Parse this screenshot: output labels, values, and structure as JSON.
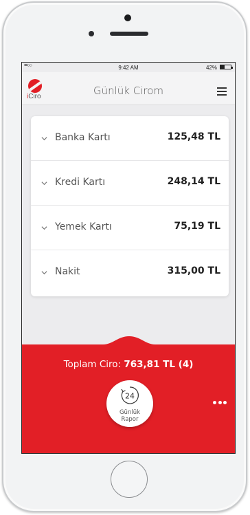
{
  "statusbar": {
    "signal": "•••○○",
    "time": "9:42 AM",
    "battery": "42%",
    "battery_level": 0.42
  },
  "header": {
    "logo_letter": "i",
    "logo_rest": "Ciro",
    "title": "Günlük Cirom"
  },
  "payments": [
    {
      "label": "Banka Kartı",
      "value": "125,48 TL"
    },
    {
      "label": "Kredi Kartı",
      "value": "248,14 TL"
    },
    {
      "label": "Yemek Kartı",
      "value": "75,19 TL"
    },
    {
      "label": "Nakit",
      "value": "315,00 TL"
    }
  ],
  "footer": {
    "total_label": "Toplam Ciro:",
    "total_value": "763,81 TL (4)",
    "report_icon_text": "24",
    "report_line1": "Günlük",
    "report_line2": "Rapor"
  },
  "colors": {
    "brand_red": "#e21f26",
    "background": "#ececee"
  }
}
